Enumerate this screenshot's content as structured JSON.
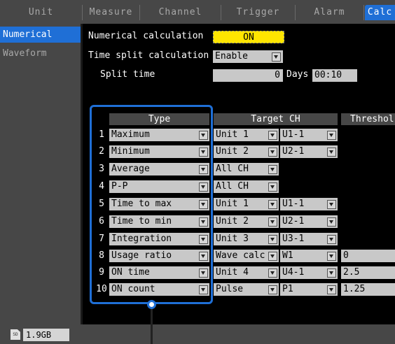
{
  "tabs": [
    {
      "label": "Unit",
      "active": false
    },
    {
      "label": "Measure",
      "active": false
    },
    {
      "label": "Channel",
      "active": false
    },
    {
      "label": "Trigger",
      "active": false
    },
    {
      "label": "Alarm",
      "active": false
    },
    {
      "label": "Calc",
      "active": true
    }
  ],
  "sidebar": [
    {
      "label": "Numerical",
      "active": true
    },
    {
      "label": "Waveform",
      "active": false
    }
  ],
  "settings": {
    "numerical_calc_label": "Numerical calculation",
    "numerical_calc_value": "ON",
    "time_split_label": "Time split calculation",
    "time_split_value": "Enable",
    "split_time_label": "Split time",
    "split_days_value": "0",
    "days_label": "Days",
    "split_time_value": "00:10"
  },
  "table": {
    "headers": {
      "type": "Type",
      "target": "Target CH",
      "threshold": "Threshol"
    },
    "rows": [
      {
        "no": "1",
        "type": "Maximum",
        "target1": "Unit 1",
        "target2": "U1-1",
        "threshold": ""
      },
      {
        "no": "2",
        "type": "Minimum",
        "target1": "Unit 2",
        "target2": "U2-1",
        "threshold": ""
      },
      {
        "no": "3",
        "type": "Average",
        "target1": "All CH",
        "target2": "",
        "threshold": ""
      },
      {
        "no": "4",
        "type": "P-P",
        "target1": "All CH",
        "target2": "",
        "threshold": ""
      },
      {
        "no": "5",
        "type": "Time to max",
        "target1": "Unit 1",
        "target2": "U1-1",
        "threshold": ""
      },
      {
        "no": "6",
        "type": "Time to min",
        "target1": "Unit 2",
        "target2": "U2-1",
        "threshold": ""
      },
      {
        "no": "7",
        "type": "Integration",
        "target1": "Unit 3",
        "target2": "U3-1",
        "threshold": ""
      },
      {
        "no": "8",
        "type": "Usage ratio",
        "target1": "Wave calc",
        "target2": "W1",
        "threshold": "0"
      },
      {
        "no": "9",
        "type": "ON time",
        "target1": "Unit 4",
        "target2": "U4-1",
        "threshold": "2.5"
      },
      {
        "no": "10",
        "type": "ON count",
        "target1": "Pulse",
        "target2": "P1",
        "threshold": "1.25"
      }
    ]
  },
  "status": {
    "sd_icon": "sd-card-icon",
    "storage": "1.9GB"
  },
  "colors": {
    "accent": "#1f6fd6",
    "highlight": "#ffe500",
    "field": "#c8c8c8"
  }
}
